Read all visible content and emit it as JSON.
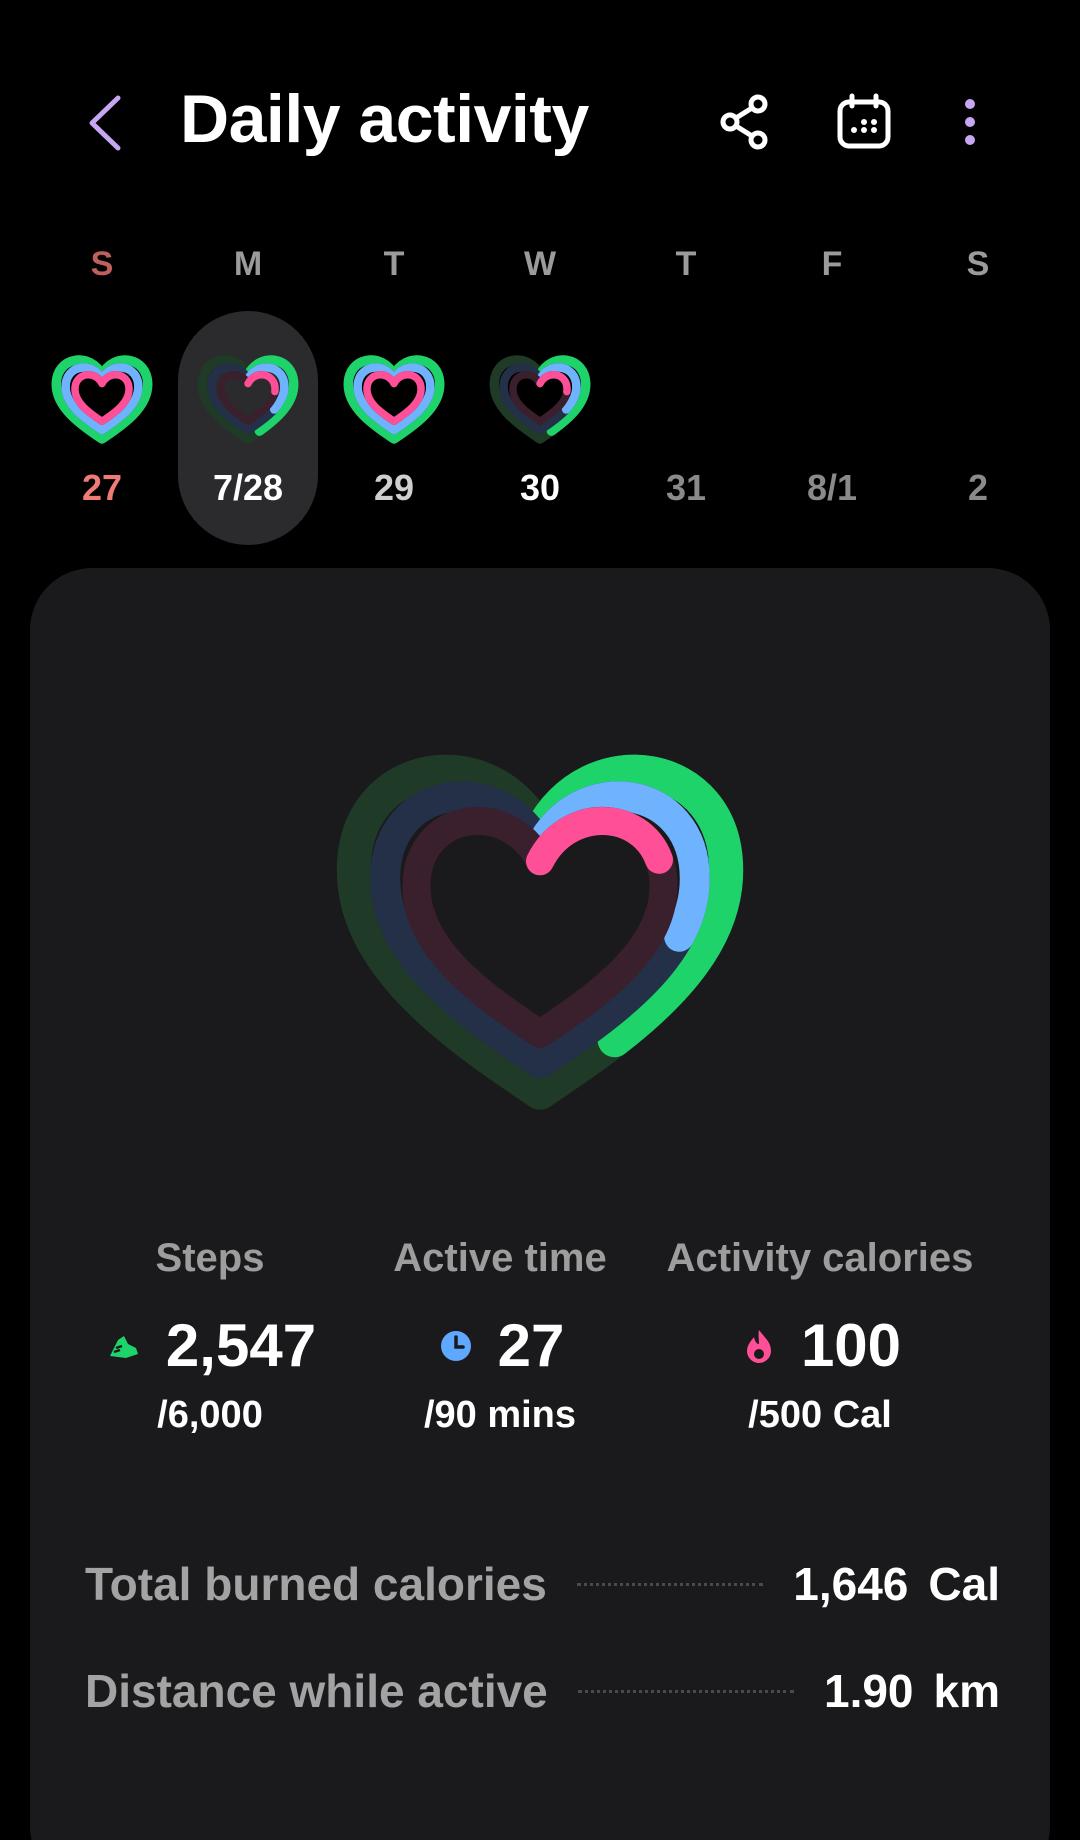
{
  "header": {
    "title": "Daily activity",
    "icons": {
      "back": "chevron-left-icon",
      "share": "share-icon",
      "calendar": "calendar-icon",
      "more": "more-vertical-icon"
    }
  },
  "week": {
    "days": [
      {
        "dow": "S",
        "date": "27"
      },
      {
        "dow": "M",
        "date": "7/28"
      },
      {
        "dow": "T",
        "date": "29"
      },
      {
        "dow": "W",
        "date": "30"
      },
      {
        "dow": "T",
        "date": "31"
      },
      {
        "dow": "F",
        "date": "8/1"
      },
      {
        "dow": "S",
        "date": "2"
      }
    ],
    "selected_index": 1
  },
  "stats": {
    "steps": {
      "label": "Steps",
      "value": "2,547",
      "goal": "/6,000",
      "icon": "shoe-icon"
    },
    "active_time": {
      "label": "Active time",
      "value": "27",
      "goal": "/90 mins",
      "icon": "clock-icon"
    },
    "activity_calories": {
      "label": "Activity calories",
      "value": "100",
      "goal": "/500 Cal",
      "icon": "flame-icon"
    }
  },
  "progress": {
    "steps": 0.42,
    "active_time": 0.3,
    "activity_calories": 0.2
  },
  "summary": {
    "total_burned": {
      "label": "Total burned calories",
      "value": "1,646",
      "unit": "Cal"
    },
    "distance": {
      "label": "Distance while active",
      "value": "1.90",
      "unit": "km"
    }
  },
  "colors": {
    "steps": "#1ed36a",
    "active_time": "#6fb3ff",
    "calories": "#ff4f97",
    "back_accent": "#c7a6f2",
    "more_accent": "#c7a6f2"
  }
}
